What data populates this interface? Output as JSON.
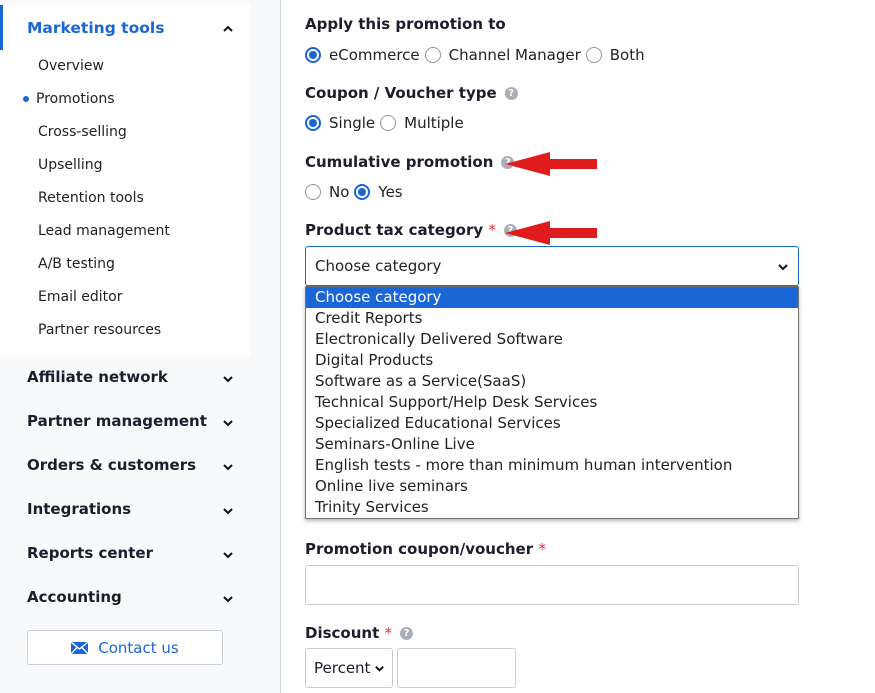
{
  "sidebar": {
    "active_section": "Marketing tools",
    "sub_items": [
      "Overview",
      "Promotions",
      "Cross-selling",
      "Upselling",
      "Retention tools",
      "Lead management",
      "A/B testing",
      "Email editor",
      "Partner resources"
    ],
    "active_sub": "Promotions",
    "sections": [
      "Affiliate network",
      "Partner management",
      "Orders & customers",
      "Integrations",
      "Reports center",
      "Accounting"
    ],
    "contact_label": "Contact us"
  },
  "form": {
    "apply_label": "Apply this promotion to",
    "apply_options": [
      "eCommerce",
      "Channel Manager",
      "Both"
    ],
    "apply_selected": "eCommerce",
    "coupon_type_label": "Coupon / Voucher type",
    "coupon_type_options": [
      "Single",
      "Multiple"
    ],
    "coupon_type_selected": "Single",
    "cumulative_label": "Cumulative promotion",
    "cumulative_options": [
      "No",
      "Yes"
    ],
    "cumulative_selected": "Yes",
    "tax_label": "Product tax category",
    "tax_value": "Choose category",
    "tax_options": [
      "Choose category",
      "Credit Reports",
      "Electronically Delivered Software",
      "Digital Products",
      "Software as a Service(SaaS)",
      "Technical Support/Help Desk Services",
      "Specialized Educational Services",
      "Seminars-Online Live",
      "English tests - more than minimum human intervention",
      "Online live seminars",
      "Trinity Services"
    ],
    "coupon_label": "Promotion coupon/voucher",
    "coupon_value": "",
    "discount_label": "Discount",
    "discount_type": "Percent",
    "discount_value": "",
    "required_mark": "*",
    "help_glyph": "?"
  },
  "colors": {
    "accent": "#1a66d6",
    "annotation_arrow": "#e01b1b",
    "required": "#e0312e"
  }
}
